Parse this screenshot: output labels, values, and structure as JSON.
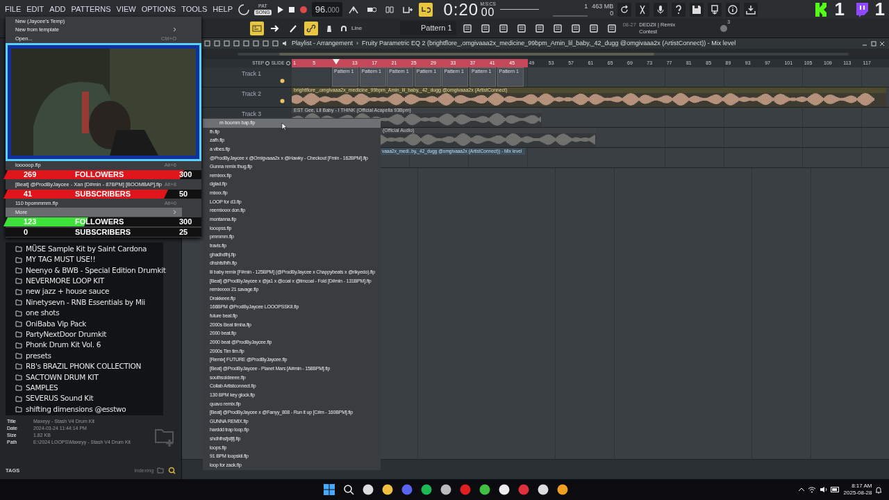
{
  "menu_bar": [
    "FILE",
    "EDIT",
    "ADD",
    "PATTERNS",
    "VIEW",
    "OPTIONS",
    "TOOLS",
    "HELP"
  ],
  "transport": {
    "mode_top": "PAT",
    "mode_bottom": "SONG",
    "song_mode": true,
    "recording": true,
    "tempo": "96.000",
    "tempo_decimals_dim": true,
    "time": "0:20",
    "time_small": "00",
    "time_unit": "M:S:CS",
    "cpu": "1",
    "memory": "463 MB",
    "polyphony": "0"
  },
  "toolbar2": {
    "snap": "Line",
    "pattern": "Pattern 1",
    "news_date": "08-27",
    "news_title": "DEDZII | Remix Contest",
    "news_count": "3"
  },
  "stream_widgets": [
    {
      "kind": "kick",
      "count": "1"
    },
    {
      "kind": "twitch",
      "count": "1"
    }
  ],
  "file_menu": {
    "items_top": [
      {
        "label": "New (Jaycee's Temp)",
        "submenu": false,
        "selected": false
      },
      {
        "label": "New from template",
        "submenu": true,
        "selected": false
      },
      {
        "label": "Open...",
        "shortcut": "Ctrl+O",
        "submenu": false,
        "selected": false
      }
    ],
    "recent": [
      {
        "label": "looooop.flp",
        "shortcut": "Alt+6",
        "submenu": false,
        "selected": false
      },
      {
        "label": "[Beat] @ProdByJaycee - Xan [D#min - 87BPM] [BOOMBAP].flp",
        "shortcut": "Alt+8",
        "submenu": false,
        "selected": false
      },
      {
        "label": "110 bpommmm.flp",
        "shortcut": "Alt+0",
        "submenu": false,
        "selected": false
      }
    ],
    "more": {
      "label": "More",
      "submenu": true,
      "selected": true
    }
  },
  "stat_bars": [
    {
      "count": "269",
      "label": "FOLLOWERS",
      "goal": "300",
      "color": "#e0141b",
      "level": 0.9
    },
    {
      "count": "41",
      "label": "SUBSCRIBERS",
      "goal": "50",
      "color": "#e0141b",
      "level": 0.82
    },
    {
      "count": "123",
      "label": "FOLLOWERS",
      "goal": "300",
      "color": "#3fe23a",
      "level": 0.41
    },
    {
      "count": "0",
      "label": "SUBSCRIBERS",
      "goal": "25",
      "level": 0
    }
  ],
  "recent_files": [
    {
      "label": "m boomm bap.flp",
      "selected": true
    },
    {
      "label": "fh.flp",
      "selected": false
    },
    {
      "label": "zafh.flp",
      "selected": false
    },
    {
      "label": "a vibes.flp",
      "selected": false
    },
    {
      "label": "@ProdByJaycee x @Omigvaaa2x x @Hawky - Checkout [Fmin - 162BPM].flp",
      "selected": false
    },
    {
      "label": "Gunna remix thug.flp",
      "selected": false
    },
    {
      "label": "remixxx.flp",
      "selected": false
    },
    {
      "label": "dglad.flp",
      "selected": false
    },
    {
      "label": "mixxx.flp",
      "selected": false
    },
    {
      "label": "LOOP for d3.flp",
      "selected": false
    },
    {
      "label": "reemixxxx don.flp",
      "selected": false
    },
    {
      "label": "montanna.flp",
      "selected": false
    },
    {
      "label": "looopss.flp",
      "selected": false
    },
    {
      "label": "pmmmm.flp",
      "selected": false
    },
    {
      "label": "travis.flp",
      "selected": false
    },
    {
      "label": "ghadhdfhj.flp",
      "selected": false
    },
    {
      "label": "dhshfsfhfh.flp",
      "selected": false
    },
    {
      "label": "lil baby remix [F#min - 125BPM] (@ProdByJaycee x Chappybeats x @rikyedo).flp",
      "selected": false
    },
    {
      "label": "[Beat] @ProdByJaycee x @ja1 x @coal x @tmcoal - Fold [D#min - 131BPM].flp",
      "selected": false
    },
    {
      "label": "remixxxxx 21 savage.flp",
      "selected": false
    },
    {
      "label": "Drakkeee.flp",
      "selected": false
    },
    {
      "label": "166BPM @ProdByJaycee LOOOPSSKII.flp",
      "selected": false
    },
    {
      "label": "future beat.flp",
      "selected": false
    },
    {
      "label": "2000s Beat timba.flp",
      "selected": false
    },
    {
      "label": "2000 beat.flp",
      "selected": false
    },
    {
      "label": "2000 beat @ProdByJaycee.flp",
      "selected": false
    },
    {
      "label": "2000s Tim tim.flp",
      "selected": false
    },
    {
      "label": "[Remix] FUTURE @ProdByJaycee.flp",
      "selected": false
    },
    {
      "label": "[Beat] @ProdByJaycee - Planet Mars [A#min - 158BPM].flp",
      "selected": false
    },
    {
      "label": "southsoideeee.flp",
      "selected": false
    },
    {
      "label": "Collab Artistconnect.flp",
      "selected": false
    },
    {
      "label": "130 BPM key glock.flp",
      "selected": false
    },
    {
      "label": "quavo remix.flp",
      "selected": false
    },
    {
      "label": "[Beat] @ProdByJaycee x @Fanyy_808 - Run it up [C#m - 160BPM].flp",
      "selected": false
    },
    {
      "label": "GUNNA REMIX.flp",
      "selected": false
    },
    {
      "label": "harddd trap loop.flp",
      "selected": false
    },
    {
      "label": "shdhfhsfjsfjfj.flp",
      "selected": false
    },
    {
      "label": "loops.flp",
      "selected": false
    },
    {
      "label": "91 BPM loopskii.flp",
      "selected": false
    },
    {
      "label": "loop for zack.flp",
      "selected": false
    }
  ],
  "browser": {
    "folders": [
      "MÜSE Sample Kit by Saint Cardona",
      "MY TAG MUST USE!!",
      "Neenyo & BWB - Special Edition Drumkit",
      "NEVERMORE LOOP KIT",
      "new jazz + house sauce",
      "Ninetysevn - RNB Essentials by Mii",
      "one shots",
      "OniBaba Vip Pack",
      "PartyNextDoor Drumkit",
      "Phonk Drum Kit Vol. 6",
      "presets",
      "RB's BRAZIL PHONK COLLECTION",
      "SACTOWN DRUM KIT",
      "SAMPLES",
      "SEVERUS Sound Kit",
      "shifting dimensions @esstwo"
    ],
    "info": [
      {
        "key": "Title",
        "value": "Maxeyy - Stash V4 Drum Kit"
      },
      {
        "key": "Date",
        "value": "2024-03-24 11:44:14 PM"
      },
      {
        "key": "Size",
        "value": "1.82 KB"
      },
      {
        "key": "Path",
        "value": "E:\\2024 LOOPS\\Maxeyy - Stash V4 Drum Kit"
      }
    ],
    "tags_label": "TAGS",
    "indexing": "Indexing"
  },
  "playlist": {
    "title": "Playlist - Arrangement",
    "separator": "›",
    "detail": "Fruity Parametric EQ 2 (brightflore_,omgivaaa2x_medicine_99bpm_Amin_lil_baby,_42_dugg @omgivaaa2x (ArtistConnect)) - Mix level",
    "step_label": "STEP",
    "slide_label": "SLIDE",
    "ruler": [
      {
        "label": "1",
        "in_loop": true
      },
      {
        "label": "5",
        "in_loop": true
      },
      {
        "in_loop": true
      },
      {
        "label": "13",
        "in_loop": true
      },
      {
        "label": "17",
        "in_loop": true
      },
      {
        "label": "21",
        "in_loop": true
      },
      {
        "label": "25",
        "in_loop": true
      },
      {
        "label": "29",
        "in_loop": true
      },
      {
        "label": "33",
        "in_loop": true
      },
      {
        "label": "37",
        "in_loop": true
      },
      {
        "label": "41",
        "in_loop": true
      },
      {
        "label": "45",
        "in_loop": true
      },
      {
        "label": "49",
        "in_loop": false
      },
      {
        "label": "53",
        "in_loop": false
      },
      {
        "label": "57",
        "in_loop": false
      },
      {
        "label": "61",
        "in_loop": false
      },
      {
        "label": "65",
        "in_loop": false
      },
      {
        "label": "69",
        "in_loop": false
      },
      {
        "label": "73",
        "in_loop": false
      },
      {
        "label": "77",
        "in_loop": false
      },
      {
        "label": "81",
        "in_loop": false
      },
      {
        "label": "85",
        "in_loop": false
      },
      {
        "label": "89",
        "in_loop": false
      },
      {
        "label": "93",
        "in_loop": false
      },
      {
        "label": "97",
        "in_loop": false
      },
      {
        "label": "101",
        "in_loop": false
      },
      {
        "label": "105",
        "in_loop": false
      },
      {
        "label": "109",
        "in_loop": false
      },
      {
        "label": "113",
        "in_loop": false
      },
      {
        "label": "117",
        "in_loop": false
      }
    ],
    "tracks": [
      {
        "name": "Track 1",
        "indicator_on": true,
        "clips": [
          {
            "kind": "pattern",
            "label": "Pattern 1"
          },
          {
            "kind": "pattern",
            "label": "Pattern 1"
          },
          {
            "kind": "pattern",
            "label": "Pattern 1"
          },
          {
            "kind": "pattern",
            "label": "Pattern 1"
          },
          {
            "kind": "pattern",
            "label": "Pattern 1"
          },
          {
            "kind": "pattern",
            "label": "Pattern 1"
          },
          {
            "kind": "pattern",
            "label": "Pattern 1"
          }
        ]
      },
      {
        "name": "Track 2",
        "indicator_on": true,
        "clips": [
          {
            "kind": "audio",
            "label": "brightflore_,omgivaaa2x_medicine_99bpm_Amin_lil_baby,_42_dugg @omgivaaa2x (ArtistConnect)"
          }
        ]
      },
      {
        "name": "Track 3",
        "clips": [
          {
            "kind": "vocal",
            "label": "EST Gee, Lil Baby - I THINK (Official Acapella 93Bpm)"
          }
        ]
      },
      {
        "clips": [
          {
            "kind": "vocal",
            "label": "(Official Audio)"
          }
        ]
      },
      {
        "clips": [
          {
            "kind": "automation",
            "label": "vaaa2x_medi..by,_42_dugg @omgivaaa2x (ArtistConnect)) - Mix level"
          }
        ]
      }
    ]
  },
  "taskbar": {
    "time": "8:17 AM",
    "date": "2025-08-28"
  }
}
